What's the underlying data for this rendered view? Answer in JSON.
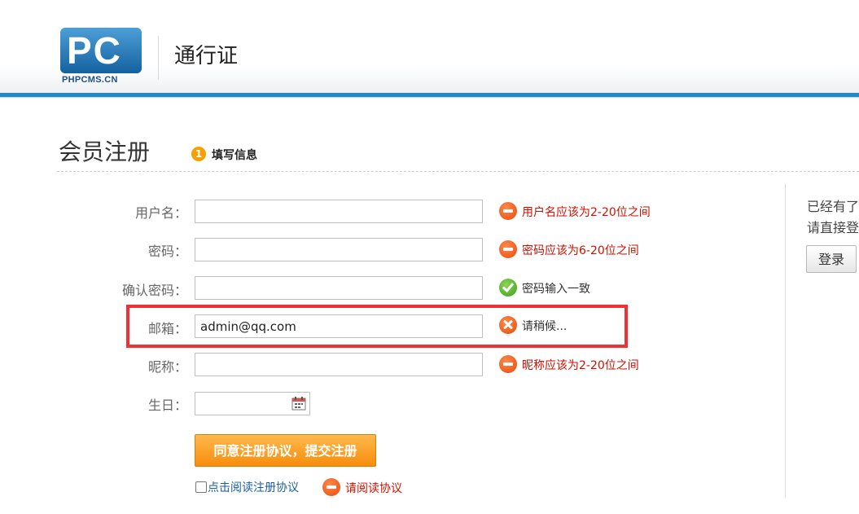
{
  "header": {
    "logo_letters": "PC",
    "logo_text": "PHPCMS.CN",
    "site_title": "通行证"
  },
  "page": {
    "title": "会员注册",
    "step_number": "1",
    "step_label": "填写信息"
  },
  "form": {
    "username_label": "用户名：",
    "username_value": "",
    "username_msg": "用户名应该为2-20位之间",
    "password_label": "密码：",
    "password_value": "",
    "password_msg": "密码应该为6-20位之间",
    "confirm_label": "确认密码：",
    "confirm_value": "",
    "confirm_msg": "密码输入一致",
    "email_label": "邮箱：",
    "email_value": "admin@qq.com",
    "email_msg": "请稍候...",
    "nickname_label": "昵称：",
    "nickname_value": "",
    "nickname_msg": "昵称应该为2-20位之间",
    "birthday_label": "生日：",
    "submit_label": "同意注册协议，提交注册",
    "agree_label": "点击阅读注册协议",
    "agree_msg": "请阅读协议"
  },
  "sidebar": {
    "line1": "已经有了",
    "line2": "请直接登",
    "login_label": "登录"
  },
  "colors": {
    "accent_blue": "#1f8cc8",
    "error_red": "#cc1100",
    "button_orange": "#f78d0c",
    "highlight_red": "#ee3337"
  },
  "icons": {
    "error": "minus-circle-icon",
    "success": "check-circle-icon",
    "loading": "x-circle-icon",
    "calendar": "calendar-icon"
  }
}
